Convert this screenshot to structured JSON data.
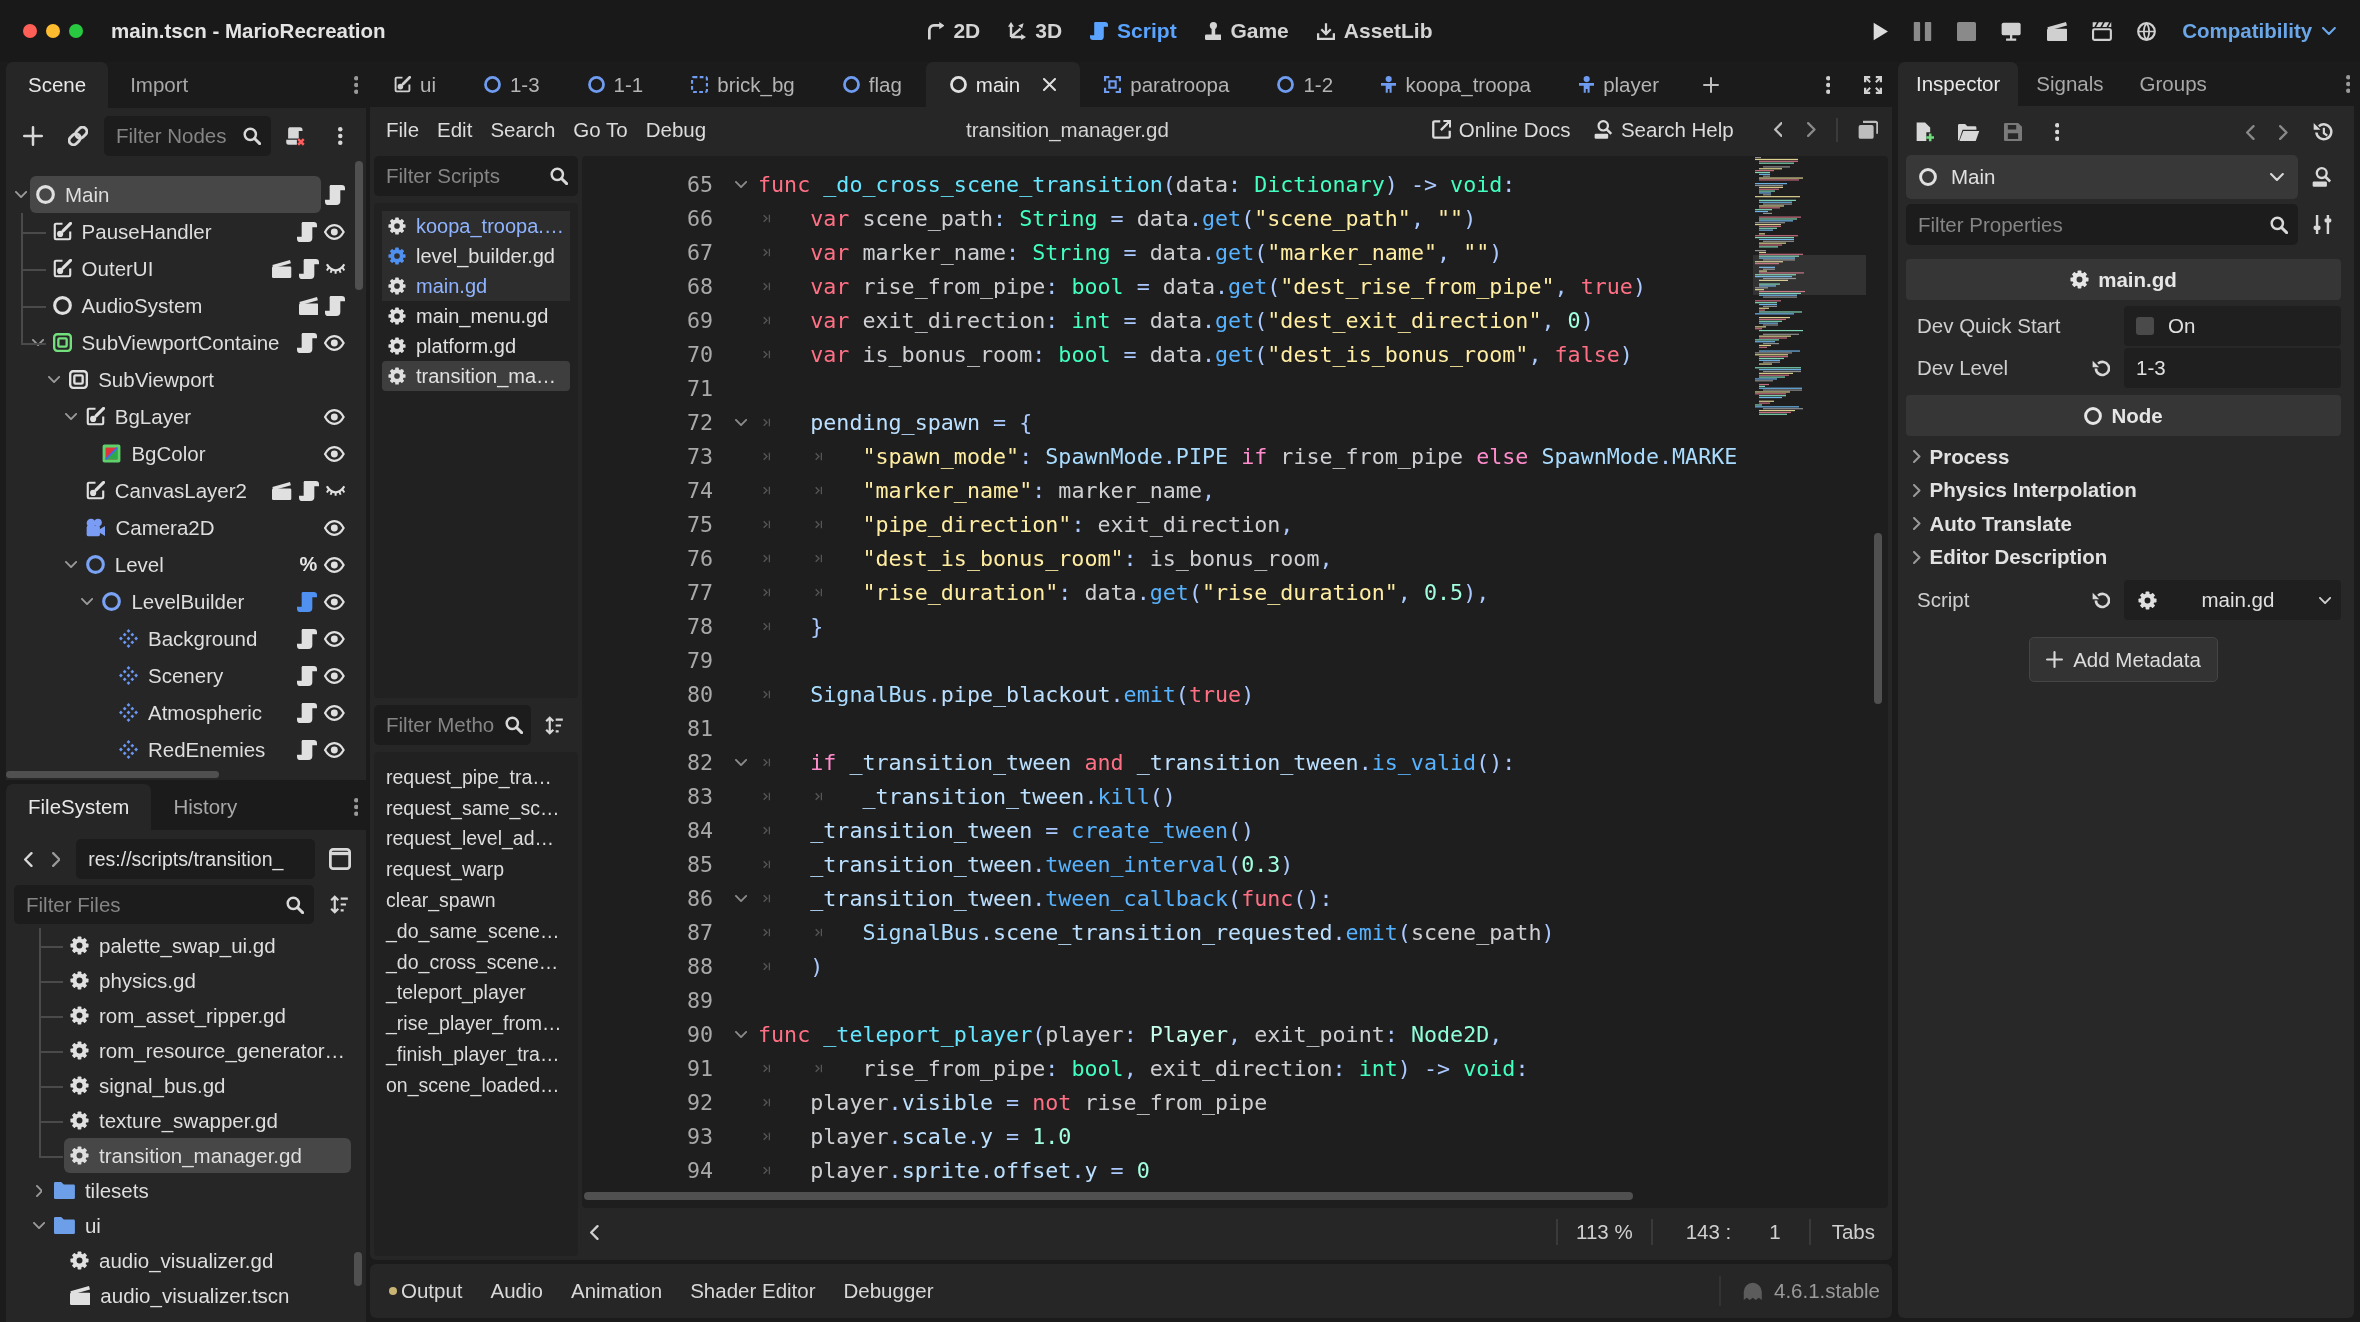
{
  "window": {
    "title": "main.tscn - MarioRecreation"
  },
  "workspaces": [
    {
      "kind": "planar",
      "label": "2D",
      "selected": false
    },
    {
      "kind": "spatial",
      "label": "3D",
      "selected": false
    },
    {
      "kind": "script",
      "label": "Script",
      "selected": true
    },
    {
      "kind": "game",
      "label": "Game",
      "selected": false
    },
    {
      "kind": "assetlib",
      "label": "AssetLib",
      "selected": false
    }
  ],
  "renderer": {
    "label": "Compatibility"
  },
  "scene_dock": {
    "tabs": [
      {
        "label": "Scene",
        "selected": true
      },
      {
        "label": "Import",
        "selected": false
      }
    ],
    "filter": {
      "placeholder": "Filter Nodes"
    },
    "tree": [
      {
        "name": "Main",
        "kind": "node",
        "selected": true,
        "expanded": true,
        "script": true,
        "tool": false,
        "children": [
          {
            "name": "PauseHandler",
            "kind": "canvas",
            "selected": false,
            "script": true,
            "tool": false,
            "visible": true
          },
          {
            "name": "OuterUI",
            "kind": "canvas",
            "selected": false,
            "instance": true,
            "script": true,
            "tool": false,
            "visible": false
          },
          {
            "name": "AudioSystem",
            "kind": "node",
            "selected": false,
            "instance": true,
            "script": true,
            "tool": false
          },
          {
            "name": "SubViewportContaine",
            "kind": "container",
            "selected": false,
            "expanded": true,
            "script": true,
            "tool": false,
            "visible": true,
            "children": [
              {
                "name": "SubViewport",
                "kind": "viewport",
                "selected": false,
                "expanded": true,
                "children": [
                  {
                    "name": "BgLayer",
                    "kind": "canvas",
                    "selected": false,
                    "expanded": true,
                    "visible": true,
                    "children": [
                      {
                        "name": "BgColor",
                        "kind": "colorrect",
                        "selected": false,
                        "visible": true
                      }
                    ]
                  },
                  {
                    "name": "CanvasLayer2",
                    "kind": "canvas",
                    "selected": false,
                    "instance": true,
                    "script": true,
                    "tool": false,
                    "visible": false
                  },
                  {
                    "name": "Camera2D",
                    "kind": "camera",
                    "selected": false,
                    "visible": true
                  },
                  {
                    "name": "Level",
                    "kind": "node2d",
                    "selected": false,
                    "expanded": true,
                    "unique": "%",
                    "visible": true,
                    "children": [
                      {
                        "name": "LevelBuilder",
                        "kind": "node2d",
                        "selected": false,
                        "expanded": true,
                        "script": true,
                        "tool": true,
                        "visible": true,
                        "children": [
                          {
                            "name": "Background",
                            "kind": "tilemap",
                            "selected": false,
                            "script": true,
                            "tool": false,
                            "visible": true
                          },
                          {
                            "name": "Scenery",
                            "kind": "tilemap",
                            "selected": false,
                            "script": true,
                            "tool": false,
                            "visible": true
                          },
                          {
                            "name": "Atmospheric",
                            "kind": "tilemap",
                            "selected": false,
                            "script": true,
                            "tool": false,
                            "visible": true
                          },
                          {
                            "name": "RedEnemies",
                            "kind": "tilemap",
                            "selected": false,
                            "script": true,
                            "tool": false,
                            "visible": true
                          }
                        ]
                      }
                    ]
                  }
                ]
              }
            ]
          }
        ]
      }
    ]
  },
  "filesystem_dock": {
    "tabs": [
      {
        "label": "FileSystem",
        "selected": true
      },
      {
        "label": "History",
        "selected": false
      }
    ],
    "path": "res://scripts/transition_",
    "filter": {
      "placeholder": "Filter Files"
    },
    "partial_folder": {
      "children": [
        {
          "name": "palette_swap_ui.gd",
          "kind": "script",
          "selected": false
        },
        {
          "name": "physics.gd",
          "kind": "script",
          "selected": false
        },
        {
          "name": "rom_asset_ripper.gd",
          "kind": "script",
          "selected": false
        },
        {
          "name": "rom_resource_generator…",
          "kind": "script",
          "selected": false
        },
        {
          "name": "signal_bus.gd",
          "kind": "script",
          "selected": false
        },
        {
          "name": "texture_swapper.gd",
          "kind": "script",
          "selected": false
        },
        {
          "name": "transition_manager.gd",
          "kind": "script",
          "selected": true
        }
      ]
    },
    "items": [
      {
        "name": "tilesets",
        "kind": "folder",
        "selected": false,
        "expanded": false
      },
      {
        "name": "ui",
        "kind": "folder",
        "selected": false,
        "expanded": true,
        "children": [
          {
            "name": "audio_visualizer.gd",
            "kind": "script",
            "selected": false
          },
          {
            "name": "audio_visualizer.tscn",
            "kind": "scene",
            "selected": false
          }
        ]
      }
    ]
  },
  "scene_tabs": [
    {
      "label": "ui",
      "kind": "canvas",
      "selected": false
    },
    {
      "label": "1-3",
      "kind": "node2d",
      "selected": false
    },
    {
      "label": "1-1",
      "kind": "node2d",
      "selected": false
    },
    {
      "label": "brick_bg",
      "kind": "tiles",
      "selected": false
    },
    {
      "label": "flag",
      "kind": "node2d",
      "selected": false
    },
    {
      "label": "main",
      "kind": "node",
      "selected": true
    },
    {
      "label": "paratroopa",
      "kind": "frame",
      "selected": false
    },
    {
      "label": "1-2",
      "kind": "node2d",
      "selected": false
    },
    {
      "label": "koopa_troopa",
      "kind": "character",
      "selected": false
    },
    {
      "label": "player",
      "kind": "character",
      "selected": false
    }
  ],
  "script_editor": {
    "menu": [
      "File",
      "Edit",
      "Search",
      "Go To",
      "Debug"
    ],
    "file_title": "transition_manager.gd",
    "help": [
      {
        "label": "Online Docs",
        "kind": "docs"
      },
      {
        "label": "Search Help",
        "kind": "search"
      }
    ],
    "scripts_filter": {
      "placeholder": "Filter Scripts"
    },
    "scripts": [
      {
        "label": "koopa_troopa.…",
        "color": "#8fb3ff",
        "tool": false,
        "highlighted": true,
        "selected": false
      },
      {
        "label": "level_builder.gd",
        "color": "#e0e0e0",
        "tool": true,
        "highlighted": true,
        "selected": false
      },
      {
        "label": "main.gd",
        "color": "#8fb3ff",
        "tool": false,
        "highlighted": true,
        "selected": false
      },
      {
        "label": "main_menu.gd",
        "color": "#e0e0e0",
        "tool": false,
        "highlighted": false,
        "selected": false
      },
      {
        "label": "platform.gd",
        "color": "#e0e0e0",
        "tool": false,
        "highlighted": false,
        "selected": false
      },
      {
        "label": "transition_ma…",
        "color": "#e0e0e0",
        "tool": false,
        "highlighted": false,
        "selected": true
      }
    ],
    "methods_filter": {
      "placeholder": "Filter Metho"
    },
    "methods": [
      "request_pipe_tra…",
      "request_same_sc…",
      "request_level_ad…",
      "request_warp",
      "clear_spawn",
      "_do_same_scene…",
      "_do_cross_scene…",
      "_teleport_player",
      "_rise_player_from…",
      "_finish_player_tra…",
      "on_scene_loaded…"
    ],
    "code_lines": [
      {
        "number": "65",
        "kind": "code",
        "tokens": [
          {
            "kind": "keyword",
            "text": "func "
          },
          {
            "kind": "funcdef",
            "text": "_do_cross_scene_transition"
          },
          {
            "kind": "symbol",
            "text": "("
          },
          {
            "kind": "text",
            "text": "data"
          },
          {
            "kind": "symbol",
            "text": ": "
          },
          {
            "kind": "type",
            "text": "Dictionary"
          },
          {
            "kind": "symbol",
            "text": ") -> "
          },
          {
            "kind": "type",
            "text": "void"
          },
          {
            "kind": "symbol",
            "text": ":"
          }
        ],
        "children": [
          {
            "number": "66",
            "kind": "code",
            "tokens": [
              {
                "kind": "keyword",
                "text": "var"
              },
              {
                "kind": "text",
                "text": " scene_path"
              },
              {
                "kind": "symbol",
                "text": ": "
              },
              {
                "kind": "type",
                "text": "String"
              },
              {
                "kind": "symbol",
                "text": " = "
              },
              {
                "kind": "text",
                "text": "data"
              },
              {
                "kind": "symbol",
                "text": "."
              },
              {
                "kind": "function",
                "text": "get"
              },
              {
                "kind": "symbol",
                "text": "("
              },
              {
                "kind": "string",
                "text": "\"scene_path\""
              },
              {
                "kind": "symbol",
                "text": ", "
              },
              {
                "kind": "string",
                "text": "\"\""
              },
              {
                "kind": "symbol",
                "text": ")"
              }
            ]
          },
          {
            "number": "67",
            "kind": "code",
            "tokens": [
              {
                "kind": "keyword",
                "text": "var"
              },
              {
                "kind": "text",
                "text": " marker_name"
              },
              {
                "kind": "symbol",
                "text": ": "
              },
              {
                "kind": "type",
                "text": "String"
              },
              {
                "kind": "symbol",
                "text": " = "
              },
              {
                "kind": "text",
                "text": "data"
              },
              {
                "kind": "symbol",
                "text": "."
              },
              {
                "kind": "function",
                "text": "get"
              },
              {
                "kind": "symbol",
                "text": "("
              },
              {
                "kind": "string",
                "text": "\"marker_name\""
              },
              {
                "kind": "symbol",
                "text": ", "
              },
              {
                "kind": "string",
                "text": "\"\""
              },
              {
                "kind": "symbol",
                "text": ")"
              }
            ]
          },
          {
            "number": "68",
            "kind": "code",
            "tokens": [
              {
                "kind": "keyword",
                "text": "var"
              },
              {
                "kind": "text",
                "text": " rise_from_pipe"
              },
              {
                "kind": "symbol",
                "text": ": "
              },
              {
                "kind": "type",
                "text": "bool"
              },
              {
                "kind": "symbol",
                "text": " = "
              },
              {
                "kind": "text",
                "text": "data"
              },
              {
                "kind": "symbol",
                "text": "."
              },
              {
                "kind": "function",
                "text": "get"
              },
              {
                "kind": "symbol",
                "text": "("
              },
              {
                "kind": "string",
                "text": "\"dest_rise_from_pipe\""
              },
              {
                "kind": "symbol",
                "text": ", "
              },
              {
                "kind": "keyword",
                "text": "true"
              },
              {
                "kind": "symbol",
                "text": ")"
              }
            ]
          },
          {
            "number": "69",
            "kind": "code",
            "tokens": [
              {
                "kind": "keyword",
                "text": "var"
              },
              {
                "kind": "text",
                "text": " exit_direction"
              },
              {
                "kind": "symbol",
                "text": ": "
              },
              {
                "kind": "type",
                "text": "int"
              },
              {
                "kind": "symbol",
                "text": " = "
              },
              {
                "kind": "text",
                "text": "data"
              },
              {
                "kind": "symbol",
                "text": "."
              },
              {
                "kind": "function",
                "text": "get"
              },
              {
                "kind": "symbol",
                "text": "("
              },
              {
                "kind": "string",
                "text": "\"dest_exit_direction\""
              },
              {
                "kind": "symbol",
                "text": ", "
              },
              {
                "kind": "number",
                "text": "0"
              },
              {
                "kind": "symbol",
                "text": ")"
              }
            ]
          },
          {
            "number": "70",
            "kind": "code",
            "tokens": [
              {
                "kind": "keyword",
                "text": "var"
              },
              {
                "kind": "text",
                "text": " is_bonus_room"
              },
              {
                "kind": "symbol",
                "text": ": "
              },
              {
                "kind": "type",
                "text": "bool"
              },
              {
                "kind": "symbol",
                "text": " = "
              },
              {
                "kind": "text",
                "text": "data"
              },
              {
                "kind": "symbol",
                "text": "."
              },
              {
                "kind": "function",
                "text": "get"
              },
              {
                "kind": "symbol",
                "text": "("
              },
              {
                "kind": "string",
                "text": "\"dest_is_bonus_room\""
              },
              {
                "kind": "symbol",
                "text": ", "
              },
              {
                "kind": "keyword",
                "text": "false"
              },
              {
                "kind": "symbol",
                "text": ")"
              }
            ]
          },
          {
            "number": "71",
            "kind": "blank"
          },
          {
            "number": "72",
            "kind": "code",
            "tokens": [
              {
                "kind": "member",
                "text": "pending_spawn"
              },
              {
                "kind": "symbol",
                "text": " = {"
              }
            ],
            "children": [
              {
                "number": "73",
                "kind": "code",
                "tokens": [
                  {
                    "kind": "string",
                    "text": "\"spawn_mode\""
                  },
                  {
                    "kind": "symbol",
                    "text": ": "
                  },
                  {
                    "kind": "global",
                    "text": "SpawnMode"
                  },
                  {
                    "kind": "symbol",
                    "text": "."
                  },
                  {
                    "kind": "global",
                    "text": "PIPE "
                  },
                  {
                    "kind": "control",
                    "text": "if"
                  },
                  {
                    "kind": "text",
                    "text": " rise_from_pipe "
                  },
                  {
                    "kind": "control",
                    "text": "else "
                  },
                  {
                    "kind": "global",
                    "text": "SpawnMode"
                  },
                  {
                    "kind": "symbol",
                    "text": "."
                  },
                  {
                    "kind": "global",
                    "text": "MARKE"
                  }
                ]
              },
              {
                "number": "74",
                "kind": "code",
                "tokens": [
                  {
                    "kind": "string",
                    "text": "\"marker_name\""
                  },
                  {
                    "kind": "symbol",
                    "text": ": "
                  },
                  {
                    "kind": "text",
                    "text": "marker_name"
                  },
                  {
                    "kind": "symbol",
                    "text": ","
                  }
                ]
              },
              {
                "number": "75",
                "kind": "code",
                "tokens": [
                  {
                    "kind": "string",
                    "text": "\"pipe_direction\""
                  },
                  {
                    "kind": "symbol",
                    "text": ": "
                  },
                  {
                    "kind": "text",
                    "text": "exit_direction"
                  },
                  {
                    "kind": "symbol",
                    "text": ","
                  }
                ]
              },
              {
                "number": "76",
                "kind": "code",
                "tokens": [
                  {
                    "kind": "string",
                    "text": "\"dest_is_bonus_room\""
                  },
                  {
                    "kind": "symbol",
                    "text": ": "
                  },
                  {
                    "kind": "text",
                    "text": "is_bonus_room"
                  },
                  {
                    "kind": "symbol",
                    "text": ","
                  }
                ]
              },
              {
                "number": "77",
                "kind": "code",
                "tokens": [
                  {
                    "kind": "string",
                    "text": "\"rise_duration\""
                  },
                  {
                    "kind": "symbol",
                    "text": ": "
                  },
                  {
                    "kind": "text",
                    "text": "data"
                  },
                  {
                    "kind": "symbol",
                    "text": "."
                  },
                  {
                    "kind": "function",
                    "text": "get"
                  },
                  {
                    "kind": "symbol",
                    "text": "("
                  },
                  {
                    "kind": "string",
                    "text": "\"rise_duration\""
                  },
                  {
                    "kind": "symbol",
                    "text": ", "
                  },
                  {
                    "kind": "number",
                    "text": "0.5"
                  },
                  {
                    "kind": "symbol",
                    "text": "),"
                  }
                ]
              }
            ]
          },
          {
            "number": "78",
            "kind": "code",
            "tokens": [
              {
                "kind": "symbol",
                "text": "}"
              }
            ]
          },
          {
            "number": "79",
            "kind": "blank"
          },
          {
            "number": "80",
            "kind": "code",
            "tokens": [
              {
                "kind": "global",
                "text": "SignalBus"
              },
              {
                "kind": "symbol",
                "text": "."
              },
              {
                "kind": "member",
                "text": "pipe_blackout"
              },
              {
                "kind": "symbol",
                "text": "."
              },
              {
                "kind": "function",
                "text": "emit"
              },
              {
                "kind": "symbol",
                "text": "("
              },
              {
                "kind": "keyword",
                "text": "true"
              },
              {
                "kind": "symbol",
                "text": ")"
              }
            ]
          },
          {
            "number": "81",
            "kind": "blank"
          },
          {
            "number": "82",
            "kind": "code",
            "tokens": [
              {
                "kind": "control",
                "text": "if "
              },
              {
                "kind": "member",
                "text": "_transition_tween"
              },
              {
                "kind": "keyword",
                "text": " and "
              },
              {
                "kind": "member",
                "text": "_transition_tween"
              },
              {
                "kind": "symbol",
                "text": "."
              },
              {
                "kind": "function",
                "text": "is_valid"
              },
              {
                "kind": "symbol",
                "text": "():"
              }
            ],
            "children": [
              {
                "number": "83",
                "kind": "code",
                "tokens": [
                  {
                    "kind": "member",
                    "text": "_transition_tween"
                  },
                  {
                    "kind": "symbol",
                    "text": "."
                  },
                  {
                    "kind": "function",
                    "text": "kill"
                  },
                  {
                    "kind": "symbol",
                    "text": "()"
                  }
                ]
              }
            ]
          },
          {
            "number": "84",
            "kind": "code",
            "tokens": [
              {
                "kind": "member",
                "text": "_transition_tween"
              },
              {
                "kind": "symbol",
                "text": " = "
              },
              {
                "kind": "function",
                "text": "create_tween"
              },
              {
                "kind": "symbol",
                "text": "()"
              }
            ]
          },
          {
            "number": "85",
            "kind": "code",
            "tokens": [
              {
                "kind": "member",
                "text": "_transition_tween"
              },
              {
                "kind": "symbol",
                "text": "."
              },
              {
                "kind": "function",
                "text": "tween_interval"
              },
              {
                "kind": "symbol",
                "text": "("
              },
              {
                "kind": "number",
                "text": "0.3"
              },
              {
                "kind": "symbol",
                "text": ")"
              }
            ]
          },
          {
            "number": "86",
            "kind": "code",
            "tokens": [
              {
                "kind": "member",
                "text": "_transition_tween"
              },
              {
                "kind": "symbol",
                "text": "."
              },
              {
                "kind": "function",
                "text": "tween_callback"
              },
              {
                "kind": "symbol",
                "text": "("
              },
              {
                "kind": "keyword",
                "text": "func"
              },
              {
                "kind": "symbol",
                "text": "():"
              }
            ],
            "children": [
              {
                "number": "87",
                "kind": "code",
                "tokens": [
                  {
                    "kind": "global",
                    "text": "SignalBus"
                  },
                  {
                    "kind": "symbol",
                    "text": "."
                  },
                  {
                    "kind": "member",
                    "text": "scene_transition_requested"
                  },
                  {
                    "kind": "symbol",
                    "text": "."
                  },
                  {
                    "kind": "function",
                    "text": "emit"
                  },
                  {
                    "kind": "symbol",
                    "text": "("
                  },
                  {
                    "kind": "text",
                    "text": "scene_path"
                  },
                  {
                    "kind": "symbol",
                    "text": ")"
                  }
                ]
              }
            ]
          },
          {
            "number": "88",
            "kind": "code",
            "tokens": [
              {
                "kind": "symbol",
                "text": ")"
              }
            ]
          }
        ]
      },
      {
        "number": "89",
        "kind": "blank"
      },
      {
        "number": "90",
        "kind": "code",
        "tokens": [
          {
            "kind": "keyword",
            "text": "func "
          },
          {
            "kind": "funcdef",
            "text": "_teleport_player"
          },
          {
            "kind": "symbol",
            "text": "("
          },
          {
            "kind": "text",
            "text": "player"
          },
          {
            "kind": "symbol",
            "text": ": "
          },
          {
            "kind": "usertype",
            "text": "Player"
          },
          {
            "kind": "symbol",
            "text": ", "
          },
          {
            "kind": "text",
            "text": "exit_point"
          },
          {
            "kind": "symbol",
            "text": ": "
          },
          {
            "kind": "enginetype",
            "text": "Node2D"
          },
          {
            "kind": "symbol",
            "text": ","
          }
        ],
        "children": [
          {
            "number": "91",
            "kind": "continuation",
            "tokens": [
              {
                "kind": "text",
                "text": "rise_from_pipe"
              },
              {
                "kind": "symbol",
                "text": ": "
              },
              {
                "kind": "type",
                "text": "bool"
              },
              {
                "kind": "symbol",
                "text": ", "
              },
              {
                "kind": "text",
                "text": "exit_direction"
              },
              {
                "kind": "symbol",
                "text": ": "
              },
              {
                "kind": "type",
                "text": "int"
              },
              {
                "kind": "symbol",
                "text": ") -> "
              },
              {
                "kind": "type",
                "text": "void"
              },
              {
                "kind": "symbol",
                "text": ":"
              }
            ]
          },
          {
            "number": "92",
            "kind": "code",
            "tokens": [
              {
                "kind": "text",
                "text": "player"
              },
              {
                "kind": "symbol",
                "text": "."
              },
              {
                "kind": "member",
                "text": "visible"
              },
              {
                "kind": "symbol",
                "text": " = "
              },
              {
                "kind": "keyword",
                "text": "not"
              },
              {
                "kind": "text",
                "text": " rise_from_pipe"
              }
            ]
          },
          {
            "number": "93",
            "kind": "code",
            "tokens": [
              {
                "kind": "text",
                "text": "player"
              },
              {
                "kind": "symbol",
                "text": "."
              },
              {
                "kind": "member",
                "text": "scale"
              },
              {
                "kind": "symbol",
                "text": "."
              },
              {
                "kind": "member",
                "text": "y"
              },
              {
                "kind": "symbol",
                "text": " = "
              },
              {
                "kind": "number",
                "text": "1.0"
              }
            ]
          },
          {
            "number": "94",
            "kind": "code",
            "tokens": [
              {
                "kind": "text",
                "text": "player"
              },
              {
                "kind": "symbol",
                "text": "."
              },
              {
                "kind": "member",
                "text": "sprite"
              },
              {
                "kind": "symbol",
                "text": "."
              },
              {
                "kind": "member",
                "text": "offset"
              },
              {
                "kind": "symbol",
                "text": "."
              },
              {
                "kind": "member",
                "text": "y"
              },
              {
                "kind": "symbol",
                "text": " = "
              },
              {
                "kind": "number",
                "text": "0"
              }
            ]
          }
        ]
      }
    ],
    "status": {
      "zoom": "113 %",
      "line": "143 :",
      "column": "1",
      "indentation": "Tabs"
    }
  },
  "inspector": {
    "tabs": [
      {
        "label": "Inspector",
        "selected": true
      },
      {
        "label": "Signals",
        "selected": false
      },
      {
        "label": "Groups",
        "selected": false
      }
    ],
    "object": {
      "name": "Main"
    },
    "filter": {
      "placeholder": "Filter Properties"
    },
    "rows": [
      {
        "kind": "script_category",
        "label": "main.gd"
      },
      {
        "kind": "check",
        "label": "Dev Quick Start",
        "checked": false,
        "value": "On"
      },
      {
        "kind": "text",
        "label": "Dev Level",
        "value": "1-3",
        "revertable": true
      },
      {
        "kind": "class_category",
        "label": "Node"
      },
      {
        "kind": "group",
        "label": "Process",
        "expanded": false
      },
      {
        "kind": "group",
        "label": "Physics Interpolation",
        "expanded": false
      },
      {
        "kind": "group",
        "label": "Auto Translate",
        "expanded": false
      },
      {
        "kind": "group",
        "label": "Editor Description",
        "expanded": false
      },
      {
        "kind": "resource",
        "label": "Script",
        "value": "main.gd",
        "revertable": true
      }
    ],
    "add_button": {
      "label": "Add Metadata"
    }
  },
  "bottom_panel": {
    "tabs": [
      {
        "label": "Output",
        "unread": true,
        "selected": false
      },
      {
        "label": "Audio",
        "unread": false,
        "selected": false
      },
      {
        "label": "Animation",
        "unread": false,
        "selected": false
      },
      {
        "label": "Shader Editor",
        "unread": false,
        "selected": false
      },
      {
        "label": "Debugger",
        "unread": false,
        "selected": false
      }
    ],
    "version": "4.6.1.stable"
  }
}
